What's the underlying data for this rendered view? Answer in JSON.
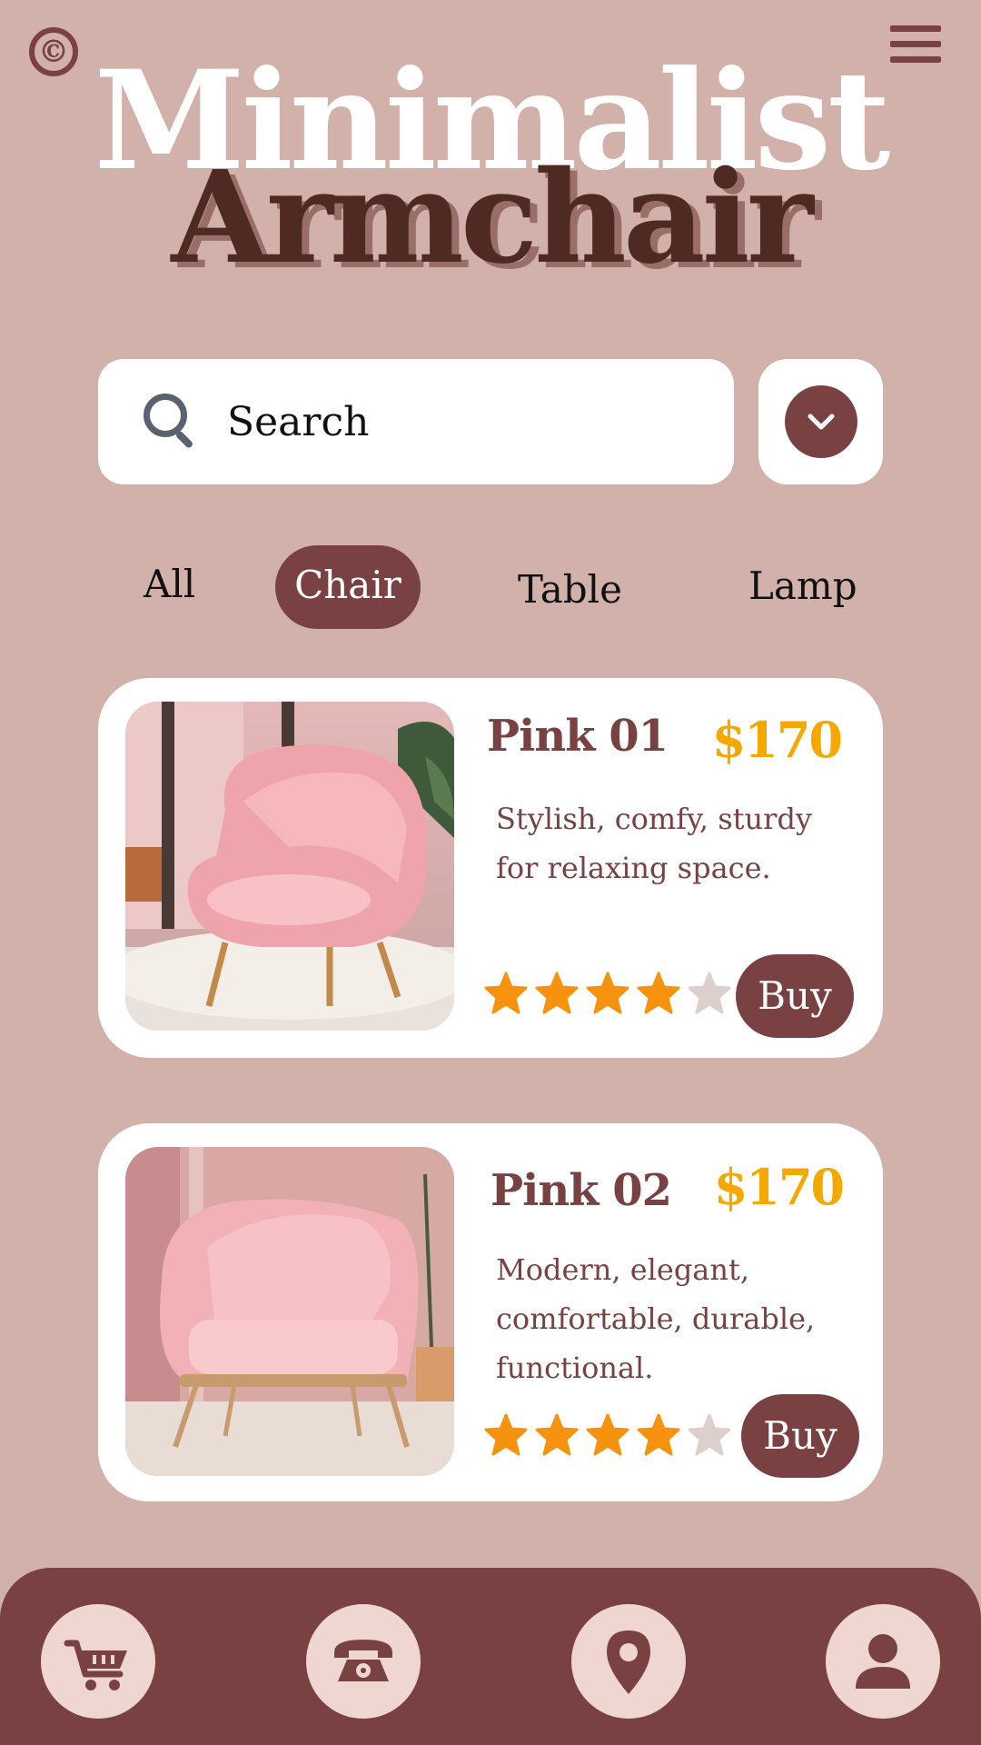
{
  "header": {
    "logo_glyph": "©",
    "title_line1": "Minimalist",
    "title_line2": "Armchair"
  },
  "search": {
    "placeholder": "Search"
  },
  "tabs": [
    {
      "label": "All",
      "active": false
    },
    {
      "label": "Chair",
      "active": true
    },
    {
      "label": "Table",
      "active": false
    },
    {
      "label": "Lamp",
      "active": false
    }
  ],
  "products": [
    {
      "name": "Pink 01",
      "price": "$170",
      "description": "Stylish, comfy, sturdy for relaxing space.",
      "rating": 4,
      "rating_max": 5,
      "buy_label": "Buy"
    },
    {
      "name": "Pink 02",
      "price": "$170",
      "description": "Modern, elegant, comfortable, durable, functional.",
      "rating": 4,
      "rating_max": 5,
      "buy_label": "Buy"
    }
  ],
  "bottom_nav": [
    {
      "icon": "cart-icon"
    },
    {
      "icon": "phone-icon"
    },
    {
      "icon": "location-icon"
    },
    {
      "icon": "user-icon"
    }
  ],
  "colors": {
    "background": "#d2b1ab",
    "primary": "#7a4143",
    "title_dark": "#4e2a22",
    "price": "#f5a800",
    "star_on": "#f7920f",
    "star_off": "#ddd0cc"
  }
}
